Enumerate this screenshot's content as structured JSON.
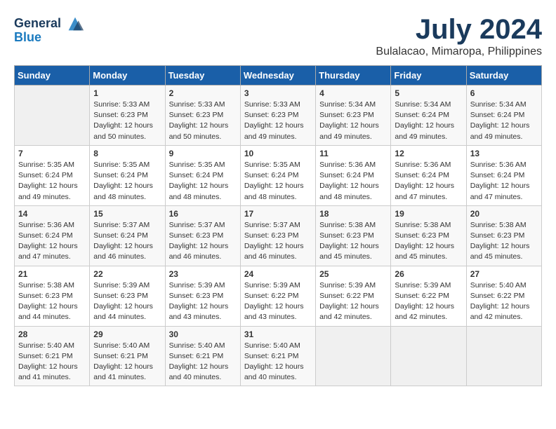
{
  "header": {
    "logo_line1": "General",
    "logo_line2": "Blue",
    "month": "July 2024",
    "location": "Bulalacao, Mimaropa, Philippines"
  },
  "days_of_week": [
    "Sunday",
    "Monday",
    "Tuesday",
    "Wednesday",
    "Thursday",
    "Friday",
    "Saturday"
  ],
  "weeks": [
    [
      {
        "day": "",
        "content": ""
      },
      {
        "day": "1",
        "content": "Sunrise: 5:33 AM\nSunset: 6:23 PM\nDaylight: 12 hours\nand 50 minutes."
      },
      {
        "day": "2",
        "content": "Sunrise: 5:33 AM\nSunset: 6:23 PM\nDaylight: 12 hours\nand 50 minutes."
      },
      {
        "day": "3",
        "content": "Sunrise: 5:33 AM\nSunset: 6:23 PM\nDaylight: 12 hours\nand 49 minutes."
      },
      {
        "day": "4",
        "content": "Sunrise: 5:34 AM\nSunset: 6:23 PM\nDaylight: 12 hours\nand 49 minutes."
      },
      {
        "day": "5",
        "content": "Sunrise: 5:34 AM\nSunset: 6:24 PM\nDaylight: 12 hours\nand 49 minutes."
      },
      {
        "day": "6",
        "content": "Sunrise: 5:34 AM\nSunset: 6:24 PM\nDaylight: 12 hours\nand 49 minutes."
      }
    ],
    [
      {
        "day": "7",
        "content": "Sunrise: 5:35 AM\nSunset: 6:24 PM\nDaylight: 12 hours\nand 49 minutes."
      },
      {
        "day": "8",
        "content": "Sunrise: 5:35 AM\nSunset: 6:24 PM\nDaylight: 12 hours\nand 48 minutes."
      },
      {
        "day": "9",
        "content": "Sunrise: 5:35 AM\nSunset: 6:24 PM\nDaylight: 12 hours\nand 48 minutes."
      },
      {
        "day": "10",
        "content": "Sunrise: 5:35 AM\nSunset: 6:24 PM\nDaylight: 12 hours\nand 48 minutes."
      },
      {
        "day": "11",
        "content": "Sunrise: 5:36 AM\nSunset: 6:24 PM\nDaylight: 12 hours\nand 48 minutes."
      },
      {
        "day": "12",
        "content": "Sunrise: 5:36 AM\nSunset: 6:24 PM\nDaylight: 12 hours\nand 47 minutes."
      },
      {
        "day": "13",
        "content": "Sunrise: 5:36 AM\nSunset: 6:24 PM\nDaylight: 12 hours\nand 47 minutes."
      }
    ],
    [
      {
        "day": "14",
        "content": "Sunrise: 5:36 AM\nSunset: 6:24 PM\nDaylight: 12 hours\nand 47 minutes."
      },
      {
        "day": "15",
        "content": "Sunrise: 5:37 AM\nSunset: 6:24 PM\nDaylight: 12 hours\nand 46 minutes."
      },
      {
        "day": "16",
        "content": "Sunrise: 5:37 AM\nSunset: 6:23 PM\nDaylight: 12 hours\nand 46 minutes."
      },
      {
        "day": "17",
        "content": "Sunrise: 5:37 AM\nSunset: 6:23 PM\nDaylight: 12 hours\nand 46 minutes."
      },
      {
        "day": "18",
        "content": "Sunrise: 5:38 AM\nSunset: 6:23 PM\nDaylight: 12 hours\nand 45 minutes."
      },
      {
        "day": "19",
        "content": "Sunrise: 5:38 AM\nSunset: 6:23 PM\nDaylight: 12 hours\nand 45 minutes."
      },
      {
        "day": "20",
        "content": "Sunrise: 5:38 AM\nSunset: 6:23 PM\nDaylight: 12 hours\nand 45 minutes."
      }
    ],
    [
      {
        "day": "21",
        "content": "Sunrise: 5:38 AM\nSunset: 6:23 PM\nDaylight: 12 hours\nand 44 minutes."
      },
      {
        "day": "22",
        "content": "Sunrise: 5:39 AM\nSunset: 6:23 PM\nDaylight: 12 hours\nand 44 minutes."
      },
      {
        "day": "23",
        "content": "Sunrise: 5:39 AM\nSunset: 6:23 PM\nDaylight: 12 hours\nand 43 minutes."
      },
      {
        "day": "24",
        "content": "Sunrise: 5:39 AM\nSunset: 6:22 PM\nDaylight: 12 hours\nand 43 minutes."
      },
      {
        "day": "25",
        "content": "Sunrise: 5:39 AM\nSunset: 6:22 PM\nDaylight: 12 hours\nand 42 minutes."
      },
      {
        "day": "26",
        "content": "Sunrise: 5:39 AM\nSunset: 6:22 PM\nDaylight: 12 hours\nand 42 minutes."
      },
      {
        "day": "27",
        "content": "Sunrise: 5:40 AM\nSunset: 6:22 PM\nDaylight: 12 hours\nand 42 minutes."
      }
    ],
    [
      {
        "day": "28",
        "content": "Sunrise: 5:40 AM\nSunset: 6:21 PM\nDaylight: 12 hours\nand 41 minutes."
      },
      {
        "day": "29",
        "content": "Sunrise: 5:40 AM\nSunset: 6:21 PM\nDaylight: 12 hours\nand 41 minutes."
      },
      {
        "day": "30",
        "content": "Sunrise: 5:40 AM\nSunset: 6:21 PM\nDaylight: 12 hours\nand 40 minutes."
      },
      {
        "day": "31",
        "content": "Sunrise: 5:40 AM\nSunset: 6:21 PM\nDaylight: 12 hours\nand 40 minutes."
      },
      {
        "day": "",
        "content": ""
      },
      {
        "day": "",
        "content": ""
      },
      {
        "day": "",
        "content": ""
      }
    ]
  ]
}
